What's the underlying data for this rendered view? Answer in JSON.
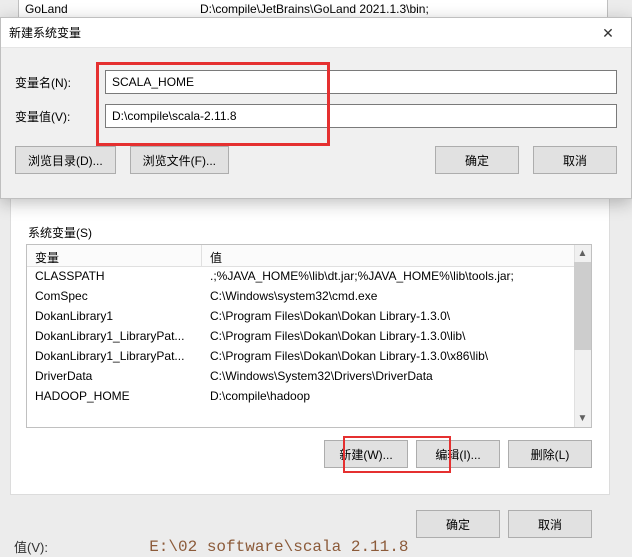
{
  "bg_top": {
    "name": "GoLand",
    "value": "D:\\compile\\JetBrains\\GoLand 2021.1.3\\bin;"
  },
  "dialog": {
    "title": "新建系统变量",
    "name_label": "变量名(N):",
    "value_label": "变量值(V):",
    "name_value": "SCALA_HOME",
    "value_value": "D:\\compile\\scala-2.11.8",
    "browse_dir": "浏览目录(D)...",
    "browse_file": "浏览文件(F)...",
    "ok": "确定",
    "cancel": "取消"
  },
  "sysvars": {
    "title": "系统变量(S)",
    "col_name": "变量",
    "col_value": "值",
    "rows": [
      {
        "name": "CLASSPATH",
        "value": ".;%JAVA_HOME%\\lib\\dt.jar;%JAVA_HOME%\\lib\\tools.jar;"
      },
      {
        "name": "ComSpec",
        "value": "C:\\Windows\\system32\\cmd.exe"
      },
      {
        "name": "DokanLibrary1",
        "value": "C:\\Program Files\\Dokan\\Dokan Library-1.3.0\\"
      },
      {
        "name": "DokanLibrary1_LibraryPat...",
        "value": "C:\\Program Files\\Dokan\\Dokan Library-1.3.0\\lib\\"
      },
      {
        "name": "DokanLibrary1_LibraryPat...",
        "value": "C:\\Program Files\\Dokan\\Dokan Library-1.3.0\\x86\\lib\\"
      },
      {
        "name": "DriverData",
        "value": "C:\\Windows\\System32\\Drivers\\DriverData"
      },
      {
        "name": "HADOOP_HOME",
        "value": "D:\\compile\\hadoop"
      }
    ],
    "new": "新建(W)...",
    "edit": "编辑(I)...",
    "delete": "删除(L)"
  },
  "outer": {
    "ok": "确定",
    "cancel": "取消"
  },
  "stray": {
    "label": "值(V):",
    "text": "  E:\\02 software\\scala 2.11.8"
  }
}
